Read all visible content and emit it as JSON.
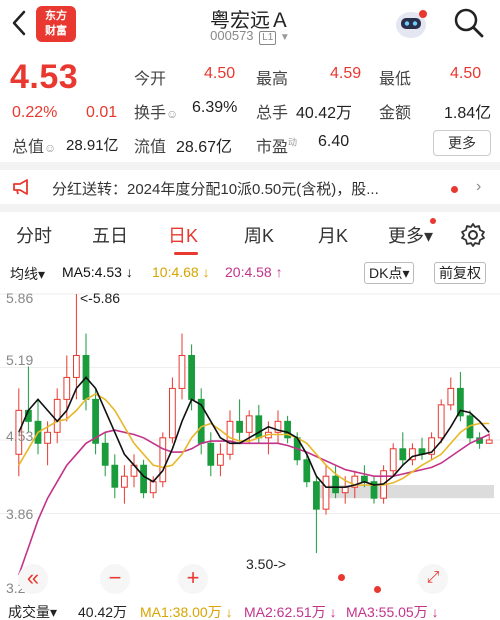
{
  "header": {
    "back_icon": "chevron-left-icon",
    "logo_line1": "东方",
    "logo_line2": "财富",
    "title": "粤宏远Ａ",
    "code": "000573",
    "level": "L1",
    "robot_icon": "robot-assistant-icon",
    "search_icon": "search-icon"
  },
  "quote": {
    "price": "4.53",
    "change_pct": "0.22%",
    "change": "0.01",
    "open_label": "今开",
    "open": "4.50",
    "high_label": "最高",
    "high": "4.59",
    "low_label": "最低",
    "low": "4.50",
    "turnover_label": "换手",
    "turnover": "6.39%",
    "volume_label": "总手",
    "volume": "40.42万",
    "amount_label": "金额",
    "amount": "1.84亿",
    "mktcap_label": "总值",
    "mktcap": "28.91亿",
    "float_label": "流值",
    "float_cap": "28.67亿",
    "pe_label": "市盈",
    "pe_sup": "动",
    "pe": "6.40",
    "more_label": "更多"
  },
  "notice": {
    "icon": "megaphone-icon",
    "text": "分红送转：2024年度分配10派0.50元(含税)，股...",
    "arrow": "›"
  },
  "tabs": [
    {
      "label": "分时"
    },
    {
      "label": "五日"
    },
    {
      "label": "日K"
    },
    {
      "label": "周K"
    },
    {
      "label": "月K"
    },
    {
      "label": "更多▾"
    }
  ],
  "settings_icon": "gear-icon",
  "ma": {
    "type_label": "均线▾",
    "ma5": "MA5:4.53 ↓",
    "ma10": "10:4.68 ↓",
    "ma20": "20:4.58 ↑",
    "dk_label": "DK点▾",
    "adjust_label": "前复权"
  },
  "colors": {
    "up": "#e8382f",
    "down": "#1a9b3c",
    "ma5": "#111111",
    "ma10": "#e8b82a",
    "ma20": "#c2338a"
  },
  "chart_data": {
    "type": "candlestick",
    "ylim": [
      3.2,
      5.86
    ],
    "yticks": [
      "5.86",
      "5.19",
      "4.53",
      "3.86",
      "3.20"
    ],
    "annotations": [
      "<-5.86",
      "3.50->"
    ],
    "ohlc": [
      [
        4.4,
        5.0,
        4.2,
        4.8
      ],
      [
        4.8,
        5.2,
        4.6,
        4.7
      ],
      [
        4.7,
        4.9,
        4.4,
        4.5
      ],
      [
        4.5,
        4.7,
        4.3,
        4.6
      ],
      [
        4.6,
        5.0,
        4.5,
        4.9
      ],
      [
        4.9,
        5.3,
        4.7,
        5.1
      ],
      [
        5.1,
        5.86,
        4.9,
        5.3
      ],
      [
        5.3,
        5.5,
        4.8,
        4.9
      ],
      [
        4.9,
        5.0,
        4.4,
        4.5
      ],
      [
        4.5,
        4.6,
        4.2,
        4.3
      ],
      [
        4.3,
        4.4,
        4.0,
        4.1
      ],
      [
        4.1,
        4.3,
        3.95,
        4.2
      ],
      [
        4.2,
        4.4,
        4.1,
        4.3
      ],
      [
        4.3,
        4.35,
        4.0,
        4.05
      ],
      [
        4.05,
        4.2,
        4.0,
        4.15
      ],
      [
        4.15,
        4.6,
        4.1,
        4.55
      ],
      [
        4.55,
        5.1,
        4.5,
        5.0
      ],
      [
        5.0,
        5.5,
        4.9,
        5.3
      ],
      [
        5.3,
        5.4,
        4.8,
        4.9
      ],
      [
        4.9,
        5.0,
        4.4,
        4.5
      ],
      [
        4.5,
        4.6,
        4.2,
        4.3
      ],
      [
        4.3,
        4.5,
        4.2,
        4.4
      ],
      [
        4.4,
        4.8,
        4.35,
        4.7
      ],
      [
        4.7,
        4.9,
        4.5,
        4.6
      ],
      [
        4.6,
        4.8,
        4.5,
        4.75
      ],
      [
        4.75,
        4.85,
        4.5,
        4.55
      ],
      [
        4.55,
        4.7,
        4.4,
        4.6
      ],
      [
        4.6,
        4.8,
        4.5,
        4.7
      ],
      [
        4.7,
        4.75,
        4.5,
        4.55
      ],
      [
        4.55,
        4.6,
        4.3,
        4.35
      ],
      [
        4.35,
        4.4,
        4.1,
        4.15
      ],
      [
        4.15,
        4.2,
        3.5,
        3.9
      ],
      [
        3.9,
        4.3,
        3.85,
        4.2
      ],
      [
        4.2,
        4.3,
        4.0,
        4.05
      ],
      [
        4.05,
        4.2,
        3.95,
        4.1
      ],
      [
        4.1,
        4.25,
        4.0,
        4.2
      ],
      [
        4.2,
        4.3,
        4.1,
        4.15
      ],
      [
        4.15,
        4.2,
        3.95,
        4.0
      ],
      [
        4.0,
        4.3,
        3.95,
        4.25
      ],
      [
        4.25,
        4.5,
        4.2,
        4.45
      ],
      [
        4.45,
        4.6,
        4.3,
        4.35
      ],
      [
        4.35,
        4.5,
        4.3,
        4.45
      ],
      [
        4.45,
        4.55,
        4.35,
        4.4
      ],
      [
        4.4,
        4.6,
        4.35,
        4.55
      ],
      [
        4.55,
        4.9,
        4.5,
        4.85
      ],
      [
        4.85,
        5.1,
        4.8,
        5.0
      ],
      [
        5.0,
        5.15,
        4.7,
        4.75
      ],
      [
        4.75,
        4.8,
        4.5,
        4.55
      ],
      [
        4.55,
        4.6,
        4.45,
        4.5
      ],
      [
        4.5,
        4.59,
        4.5,
        4.53
      ]
    ],
    "ma5": [
      4.6,
      4.8,
      4.9,
      4.8,
      4.7,
      4.8,
      5.0,
      5.1,
      5.0,
      4.8,
      4.6,
      4.4,
      4.3,
      4.2,
      4.15,
      4.25,
      4.45,
      4.7,
      4.9,
      4.85,
      4.7,
      4.55,
      4.5,
      4.5,
      4.55,
      4.6,
      4.65,
      4.62,
      4.6,
      4.55,
      4.4,
      4.2,
      4.1,
      4.1,
      4.1,
      4.12,
      4.15,
      4.12,
      4.13,
      4.2,
      4.3,
      4.38,
      4.4,
      4.42,
      4.52,
      4.65,
      4.8,
      4.78,
      4.7,
      4.6
    ],
    "ma10": [
      4.3,
      4.45,
      4.6,
      4.65,
      4.7,
      4.72,
      4.8,
      4.9,
      4.95,
      4.9,
      4.8,
      4.65,
      4.5,
      4.4,
      4.3,
      4.28,
      4.3,
      4.4,
      4.55,
      4.65,
      4.68,
      4.62,
      4.55,
      4.52,
      4.52,
      4.55,
      4.58,
      4.58,
      4.58,
      4.55,
      4.5,
      4.4,
      4.3,
      4.22,
      4.16,
      4.12,
      4.12,
      4.12,
      4.12,
      4.14,
      4.18,
      4.24,
      4.3,
      4.35,
      4.4,
      4.5,
      4.6,
      4.66,
      4.68,
      4.68
    ],
    "ma20": [
      3.3,
      3.55,
      3.8,
      4.0,
      4.15,
      4.3,
      4.4,
      4.5,
      4.55,
      4.6,
      4.62,
      4.6,
      4.58,
      4.55,
      4.5,
      4.45,
      4.42,
      4.42,
      4.45,
      4.5,
      4.52,
      4.52,
      4.52,
      4.5,
      4.5,
      4.5,
      4.5,
      4.5,
      4.48,
      4.45,
      4.42,
      4.38,
      4.34,
      4.3,
      4.26,
      4.24,
      4.22,
      4.2,
      4.2,
      4.2,
      4.22,
      4.24,
      4.26,
      4.28,
      4.32,
      4.38,
      4.44,
      4.5,
      4.54,
      4.58
    ]
  },
  "chart_controls": {
    "collapse_icon": "double-left-icon",
    "zoom_out_icon": "minus-icon",
    "zoom_in_icon": "plus-icon",
    "expand_icon": "expand-icon"
  },
  "volume": {
    "label": "成交量▾",
    "vol": "40.42万",
    "ma1": "MA1:38.00万 ↓",
    "ma2": "MA2:62.51万 ↓",
    "ma3": "MA3:55.05万 ↓"
  }
}
